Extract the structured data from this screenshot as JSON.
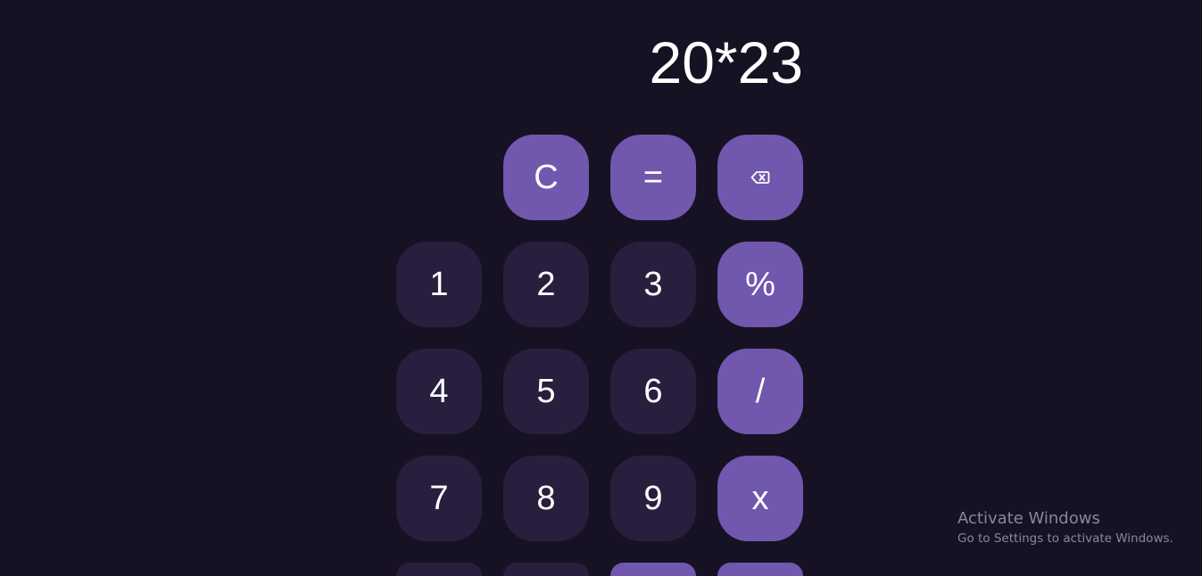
{
  "display": {
    "expression": "20*23"
  },
  "keys": {
    "clear": "C",
    "equals": "=",
    "backspace_icon": "backspace-icon",
    "one": "1",
    "two": "2",
    "three": "3",
    "percent": "%",
    "four": "4",
    "five": "5",
    "six": "6",
    "divide": "/",
    "seven": "7",
    "eight": "8",
    "nine": "9",
    "multiply": "x"
  },
  "watermark": {
    "title": "Activate Windows",
    "subtitle": "Go to Settings to activate Windows."
  },
  "colors": {
    "background": "#161224",
    "number_key": "#271f3d",
    "operator_key": "#7157ad",
    "text": "#ffffff"
  }
}
